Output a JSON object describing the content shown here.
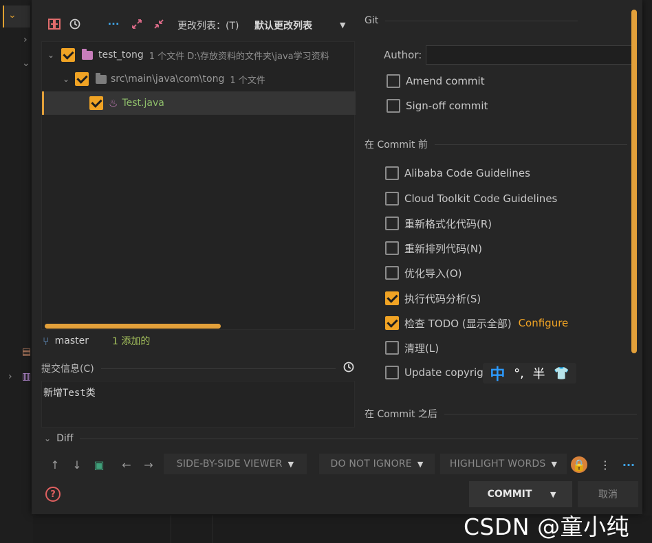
{
  "colors": {
    "accent": "#e3a03a",
    "checkbox_on": "#f0a324",
    "dialog_bg": "#262626",
    "branch_added": "#a5c25c",
    "file_green": "#8fbf6b",
    "module_purple": "#c77dbb"
  },
  "toolbar": {
    "icons": [
      "rollback-icon",
      "history-icon",
      "more-icon",
      "expand-icon",
      "collapse-icon"
    ],
    "changelist_label": "更改列表：(T)",
    "changelist_value": "默认更改列表"
  },
  "tree": {
    "rows": [
      {
        "name": "test_tong",
        "info": "1 个文件  D:\\存放资料的文件夹\\java学习资料",
        "checked": true
      },
      {
        "name": "src\\main\\java\\com\\tong",
        "info": "1 个文件",
        "checked": true
      },
      {
        "name": "Test.java",
        "info": "",
        "checked": true
      }
    ]
  },
  "branch": {
    "name": "master",
    "added": "1 添加的"
  },
  "commit_message": {
    "label": "提交信息(C)",
    "text": "新增Test类"
  },
  "git": {
    "title": "Git",
    "author_label": "Author:",
    "author_value": "",
    "amend": "Amend commit",
    "signoff": "Sign-off commit"
  },
  "before_commit": {
    "title": "在 Commit 前",
    "options": [
      {
        "label": "Alibaba Code Guidelines",
        "checked": false
      },
      {
        "label": "Cloud Toolkit Code Guidelines",
        "checked": false
      },
      {
        "label": "重新格式化代码(R)",
        "checked": false
      },
      {
        "label": "重新排列代码(N)",
        "checked": false
      },
      {
        "label": "优化导入(O)",
        "checked": false
      },
      {
        "label": "执行代码分析(S)",
        "checked": true
      },
      {
        "label": "检查 TODO (显示全部)",
        "checked": true,
        "link": "Configure"
      },
      {
        "label": "清理(L)",
        "checked": false
      },
      {
        "label": "Update copyrig",
        "checked": false
      }
    ]
  },
  "after_commit": {
    "title": "在 Commit 之后"
  },
  "ime": {
    "mode": "中",
    "punct": "°,",
    "width": "半"
  },
  "diff": {
    "title": "Diff",
    "viewer": "SIDE-BY-SIDE VIEWER",
    "ignore": "DO NOT IGNORE",
    "highlight": "HIGHLIGHT WORDS"
  },
  "footer": {
    "commit": "COMMIT",
    "cancel": "取消",
    "help_icon": "?"
  },
  "watermark": "CSDN @童小纯"
}
